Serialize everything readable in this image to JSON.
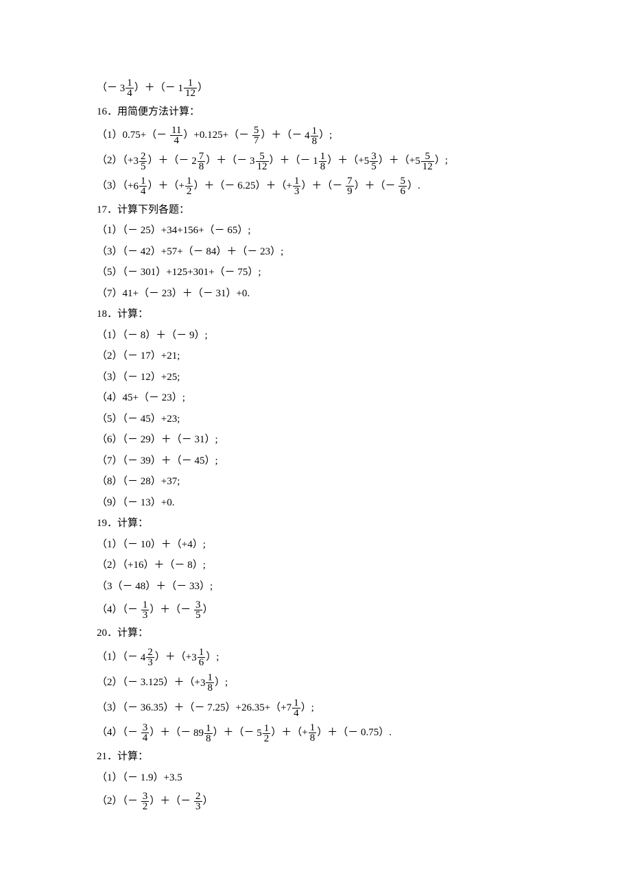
{
  "lines": [
    {
      "type": "math",
      "parts": [
        "（－ ",
        {
          "mixed": [
            3,
            1,
            4
          ]
        },
        "）＋（－ ",
        {
          "mixed": [
            1,
            1,
            12
          ]
        },
        "）"
      ]
    },
    {
      "type": "text",
      "text": "16．用简便方法计算："
    },
    {
      "type": "math",
      "parts": [
        "（1）0.75+（－ ",
        {
          "frac": [
            11,
            4
          ]
        },
        "）+0.125+（－ ",
        {
          "frac": [
            5,
            7
          ]
        },
        "）＋（－ ",
        {
          "mixed": [
            4,
            1,
            8
          ]
        },
        "）;"
      ]
    },
    {
      "type": "math",
      "parts": [
        "（2）（+",
        {
          "mixed": [
            3,
            2,
            5
          ]
        },
        "）＋（－ ",
        {
          "mixed": [
            2,
            7,
            8
          ]
        },
        "）＋（－ ",
        {
          "mixed": [
            3,
            5,
            12
          ]
        },
        "）＋（－ ",
        {
          "mixed": [
            1,
            1,
            8
          ]
        },
        "）＋（+",
        {
          "mixed": [
            5,
            3,
            5
          ]
        },
        "）＋（+",
        {
          "mixed": [
            5,
            5,
            12
          ]
        },
        "）;"
      ]
    },
    {
      "type": "math",
      "parts": [
        "（3）（+",
        {
          "mixed": [
            6,
            1,
            4
          ]
        },
        "）＋（+",
        {
          "frac": [
            1,
            2
          ]
        },
        "）＋（－ 6.25）＋（+",
        {
          "frac": [
            1,
            3
          ]
        },
        "）＋（－ ",
        {
          "frac": [
            7,
            9
          ]
        },
        "）＋（－ ",
        {
          "frac": [
            5,
            6
          ]
        },
        "）."
      ]
    },
    {
      "type": "text",
      "text": "17．计算下列各题："
    },
    {
      "type": "text",
      "text": "（1）（－ 25）+34+156+（－ 65）;"
    },
    {
      "type": "text",
      "text": "（3）（－ 42）+57+（－ 84）＋（－ 23）;"
    },
    {
      "type": "text",
      "text": "（5）（－ 301）+125+301+（－ 75）;"
    },
    {
      "type": "text",
      "text": "（7）41+（－ 23）＋（－ 31）+0."
    },
    {
      "type": "text",
      "text": "18．计算："
    },
    {
      "type": "text",
      "text": "（1）（－ 8）＋（－ 9）;"
    },
    {
      "type": "text",
      "text": "（2）（－ 17）+21;"
    },
    {
      "type": "text",
      "text": "（3）（－ 12）+25;"
    },
    {
      "type": "text",
      "text": "（4）45+（－ 23）;"
    },
    {
      "type": "text",
      "text": "（5）（－ 45）+23;"
    },
    {
      "type": "text",
      "text": "（6）（－ 29）＋（－ 31）;"
    },
    {
      "type": "text",
      "text": "（7）（－ 39）＋（－ 45）;"
    },
    {
      "type": "text",
      "text": "（8）（－ 28）+37;"
    },
    {
      "type": "text",
      "text": "（9）（－ 13）+0."
    },
    {
      "type": "text",
      "text": "19．计算："
    },
    {
      "type": "text",
      "text": "（1）（－ 10）＋（+4）;"
    },
    {
      "type": "text",
      "text": "（2）（+16）＋（－ 8）;"
    },
    {
      "type": "text",
      "text": "（3（－ 48）＋（－ 33）;"
    },
    {
      "type": "math",
      "parts": [
        "（4）（－ ",
        {
          "frac": [
            1,
            3
          ]
        },
        "）＋（－ ",
        {
          "frac": [
            3,
            5
          ]
        },
        "）"
      ]
    },
    {
      "type": "text",
      "text": "20．计算："
    },
    {
      "type": "math",
      "parts": [
        "（1）（－ ",
        {
          "mixed": [
            4,
            2,
            3
          ]
        },
        "）＋（+",
        {
          "mixed": [
            3,
            1,
            6
          ]
        },
        "）;"
      ]
    },
    {
      "type": "math",
      "parts": [
        "（2）（－ 3.125）＋（+",
        {
          "mixed": [
            3,
            1,
            8
          ]
        },
        "）;"
      ]
    },
    {
      "type": "math",
      "parts": [
        "（3）（－ 36.35）＋（－ 7.25）+26.35+（+",
        {
          "mixed": [
            7,
            1,
            4
          ]
        },
        "）;"
      ]
    },
    {
      "type": "math",
      "parts": [
        "（4）（－ ",
        {
          "frac": [
            3,
            4
          ]
        },
        "）＋（－ ",
        {
          "mixed": [
            89,
            1,
            8
          ]
        },
        "）＋（－ ",
        {
          "mixed": [
            5,
            1,
            2
          ]
        },
        "）＋（+",
        {
          "frac": [
            1,
            8
          ]
        },
        "）＋（－ 0.75）."
      ]
    },
    {
      "type": "text",
      "text": "21．计算："
    },
    {
      "type": "text",
      "text": "（1）（－ 1.9）+3.5"
    },
    {
      "type": "math",
      "parts": [
        "（2）（－ ",
        {
          "frac": [
            3,
            2
          ]
        },
        "）＋（－ ",
        {
          "frac": [
            2,
            3
          ]
        },
        "）"
      ]
    }
  ]
}
